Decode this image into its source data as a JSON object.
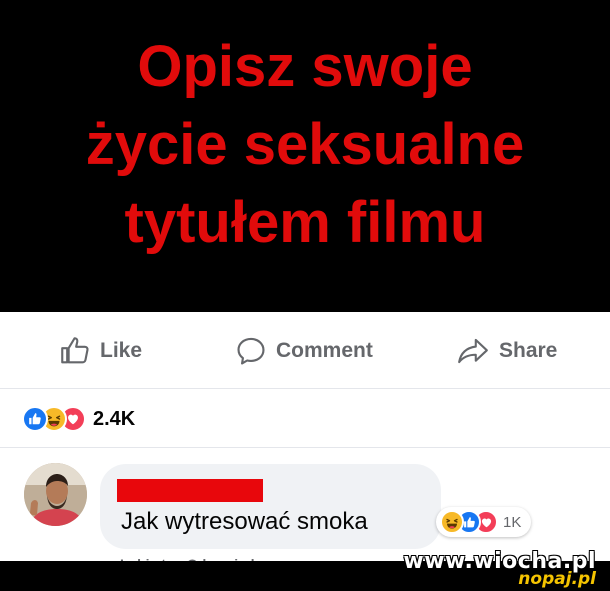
{
  "banner": {
    "lines": [
      "Opisz swoje",
      "życie seksualne",
      "tytułem filmu"
    ]
  },
  "actions": {
    "like": "Like",
    "comment": "Comment",
    "share": "Share"
  },
  "reactions": {
    "count": "2.4K",
    "icons": [
      "like-reaction-icon",
      "haha-reaction-icon",
      "love-reaction-icon"
    ]
  },
  "comment": {
    "text": "Jak wytresować smoka",
    "reaction_count": "1K",
    "below": "Lubię to · Odpowiedz"
  },
  "watermark": {
    "site": "www.wiocha.pl",
    "tag": "nopaj.pl"
  },
  "colors": {
    "banner_text": "#e10b0b",
    "redaction": "#e8070c",
    "like_blue": "#1877f2",
    "love_red": "#f33e58",
    "haha_yellow": "#f7b928"
  }
}
